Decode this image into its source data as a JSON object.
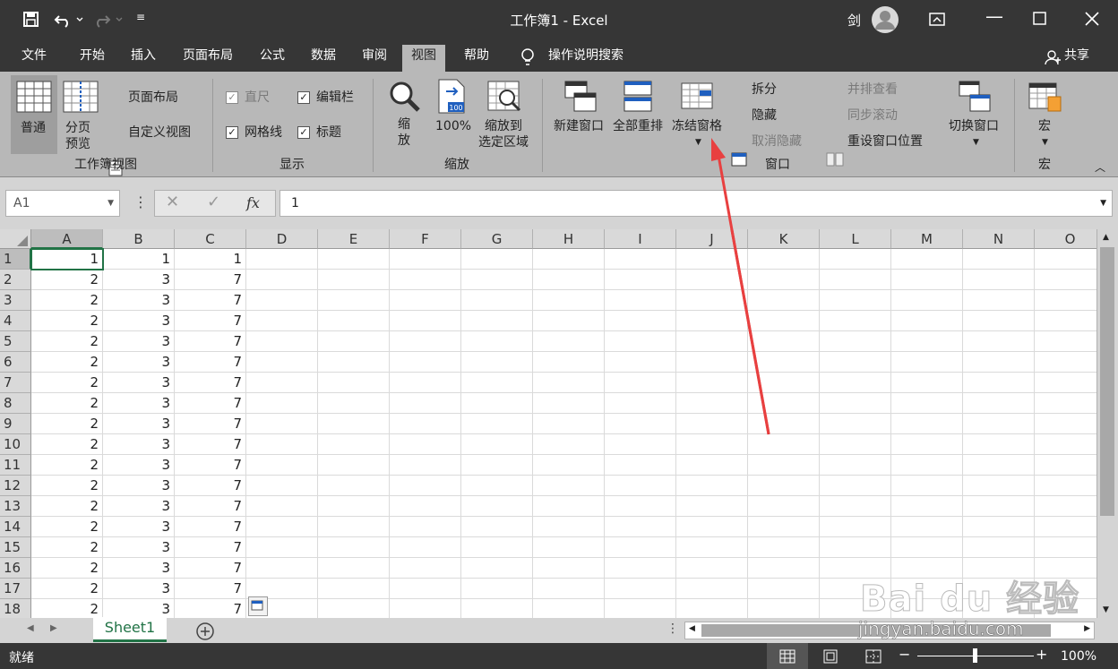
{
  "title": "工作簿1 - Excel",
  "user": "剑",
  "qat": {
    "save_icon": "save-icon",
    "undo_icon": "undo-icon",
    "redo_icon": "redo-icon"
  },
  "tabs": [
    "文件",
    "开始",
    "插入",
    "页面布局",
    "公式",
    "数据",
    "审阅",
    "视图",
    "帮助"
  ],
  "active_tab": "视图",
  "tell_me": "操作说明搜索",
  "share": "共享",
  "ribbon": {
    "workbook_views": {
      "group": "工作簿视图",
      "normal": "普通",
      "page_break": "分页\n预览",
      "page_layout": "页面布局",
      "custom_view": "自定义视图"
    },
    "show": {
      "group": "显示",
      "ruler": "直尺",
      "formula_bar": "编辑栏",
      "gridlines": "网格线",
      "headings": "标题"
    },
    "zoom": {
      "group": "缩放",
      "zoom": "缩\n放",
      "hundred": "100%",
      "to_selection": "缩放到\n选定区域"
    },
    "window": {
      "group": "窗口",
      "new_window": "新建窗口",
      "arrange_all": "全部重排",
      "freeze_panes": "冻结窗格",
      "split": "拆分",
      "hide": "隐藏",
      "unhide": "取消隐藏",
      "side_by_side": "并排查看",
      "sync_scroll": "同步滚动",
      "reset_position": "重设窗口位置",
      "switch_windows": "切换窗口"
    },
    "macros": {
      "group": "宏",
      "macros": "宏"
    }
  },
  "formula_bar": {
    "name_box": "A1",
    "fx": "fx",
    "value": "1"
  },
  "columns": [
    "A",
    "B",
    "C",
    "D",
    "E",
    "F",
    "G",
    "H",
    "I",
    "J",
    "K",
    "L",
    "M",
    "N",
    "O"
  ],
  "rows": [
    [
      "1",
      "1",
      "1"
    ],
    [
      "2",
      "3",
      "7"
    ],
    [
      "2",
      "3",
      "7"
    ],
    [
      "2",
      "3",
      "7"
    ],
    [
      "2",
      "3",
      "7"
    ],
    [
      "2",
      "3",
      "7"
    ],
    [
      "2",
      "3",
      "7"
    ],
    [
      "2",
      "3",
      "7"
    ],
    [
      "2",
      "3",
      "7"
    ],
    [
      "2",
      "3",
      "7"
    ],
    [
      "2",
      "3",
      "7"
    ],
    [
      "2",
      "3",
      "7"
    ],
    [
      "2",
      "3",
      "7"
    ],
    [
      "2",
      "3",
      "7"
    ],
    [
      "2",
      "3",
      "7"
    ],
    [
      "2",
      "3",
      "7"
    ],
    [
      "2",
      "3",
      "7"
    ],
    [
      "2",
      "3",
      "7"
    ]
  ],
  "sheet_tab": "Sheet1",
  "status": {
    "ready": "就绪",
    "zoom": "100%"
  },
  "watermark": {
    "brand": "Bai du 经验",
    "url": "jingyan.baidu.com"
  }
}
